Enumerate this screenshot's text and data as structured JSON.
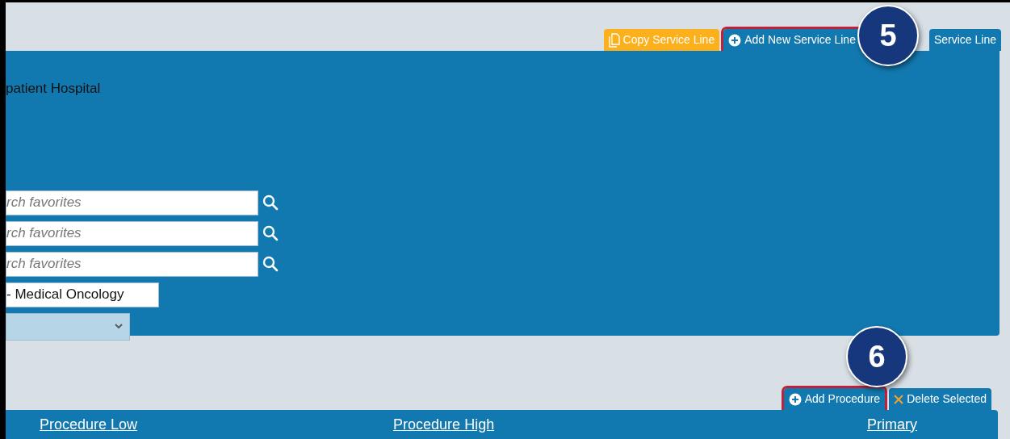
{
  "top_tabs": [
    {
      "kind": "copy",
      "label": "Copy Service Line",
      "highlighted": false
    },
    {
      "kind": "add",
      "label": "Add New Service Line",
      "highlighted": true
    },
    {
      "kind": "plain",
      "label": "Service Line",
      "highlighted": false
    }
  ],
  "panel": {
    "facility": "patient Hospital",
    "search_fields": [
      {
        "placeholder": "rch favorites"
      },
      {
        "placeholder": "rch favorites"
      },
      {
        "placeholder": "rch favorites"
      }
    ],
    "specialty": "- Medical Oncology"
  },
  "table_tabs": [
    {
      "kind": "add",
      "label": "Add Procedure",
      "highlighted": true
    },
    {
      "kind": "delete",
      "label": "Delete Selected",
      "highlighted": false
    }
  ],
  "columns": [
    "Procedure Low",
    "Procedure High",
    "Primary"
  ],
  "callouts": [
    "5",
    "6"
  ]
}
